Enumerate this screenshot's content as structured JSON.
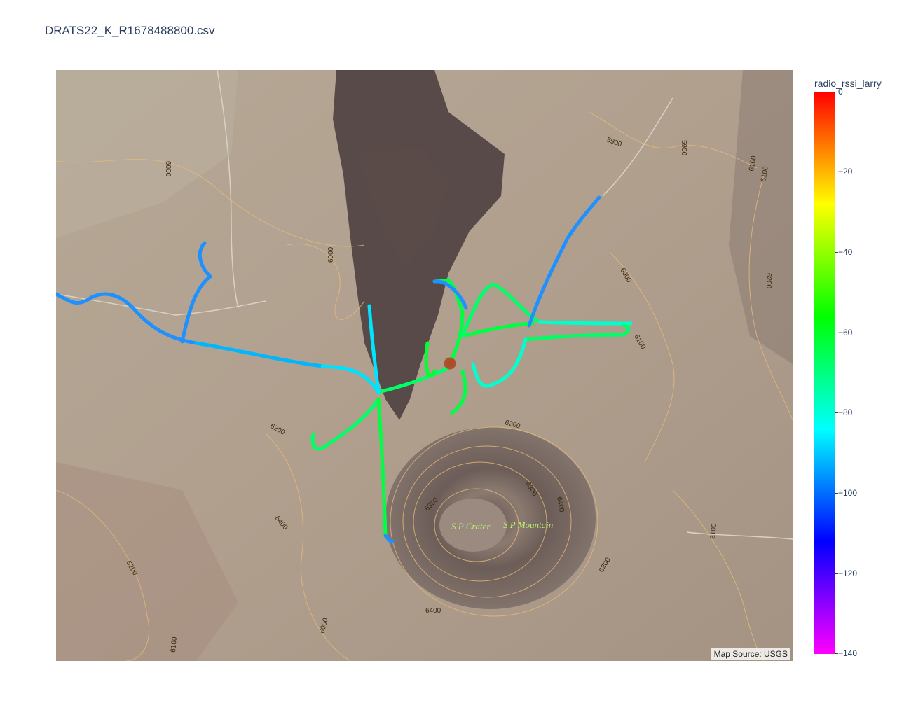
{
  "title": "DRATS22_K_R1678488800.csv",
  "map": {
    "attribution": "Map Source: USGS",
    "place_labels": {
      "crater": "S P Crater",
      "mountain": "S P Mountain"
    },
    "contour_labels": [
      "5900",
      "5800",
      "6000",
      "6100",
      "6200",
      "6300",
      "6400"
    ],
    "marker_color": "#c0392b"
  },
  "colorbar": {
    "title": "radio_rssi_larry",
    "ticks": [
      "0",
      "−20",
      "−40",
      "−60",
      "−80",
      "−100",
      "−120",
      "−140"
    ],
    "range": [
      -140,
      0
    ],
    "colors": [
      "#ff00ff",
      "#0000ff",
      "#00ffff",
      "#00ff00",
      "#ffff00",
      "#ff0000"
    ]
  }
}
